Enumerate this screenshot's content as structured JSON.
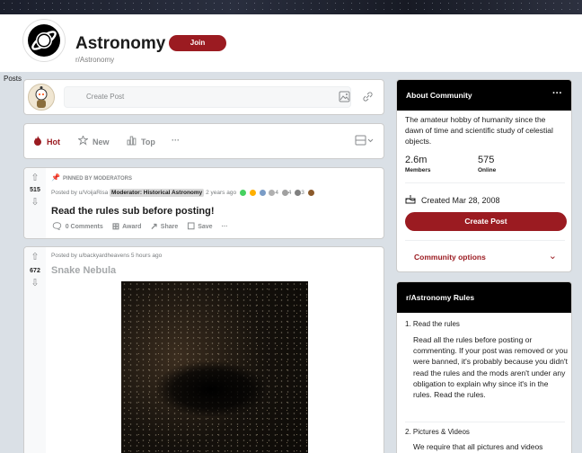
{
  "subreddit": {
    "title": "Astronomy",
    "name": "r/Astronomy",
    "join_label": "Join",
    "posts_tab": "Posts"
  },
  "create_post": {
    "placeholder": "Create Post",
    "image_icon": "image-icon",
    "link_icon": "link-icon"
  },
  "sort": {
    "hot": "Hot",
    "new": "New",
    "top": "Top",
    "more": "···"
  },
  "posts": [
    {
      "pinned_label": "PINNED BY MODERATORS",
      "score": "515",
      "posted_by": "Posted by u/VoijaRisa",
      "flair": "Moderator: Historical Astronomy",
      "time": "2 years ago",
      "award_counts": [
        "4",
        "4",
        "3"
      ],
      "title": "Read the rules sub before posting!",
      "comments": "0 Comments",
      "award": "Award",
      "share": "Share",
      "save": "Save",
      "more": "···"
    },
    {
      "score": "672",
      "posted_by": "Posted by u/backyardheavens 5 hours ago",
      "title": "Snake Nebula"
    }
  ],
  "about": {
    "heading": "About Community",
    "more": "···",
    "description": "The amateur hobby of humanity since the dawn of time and scientific study of celestial objects.",
    "members_value": "2.6m",
    "members_label": "Members",
    "online_value": "575",
    "online_label": "Online",
    "created": "Created Mar 28, 2008",
    "create_post_label": "Create Post",
    "options_label": "Community options"
  },
  "rules": {
    "heading": "r/Astronomy Rules",
    "items": [
      {
        "title": "1. Read the rules",
        "body": "Read all the rules before posting or commenting. If your post was removed or you were banned, it's probably because you didn't read the rules and the mods aren't under any obligation to explain why since it's in the rules. Read the rules."
      },
      {
        "title": "2. Pictures & Videos",
        "body": "We require that all pictures and videos"
      }
    ]
  },
  "colors": {
    "accent": "#9b1b21",
    "header_bg": "#000000",
    "page_bg": "#dae0e6"
  }
}
